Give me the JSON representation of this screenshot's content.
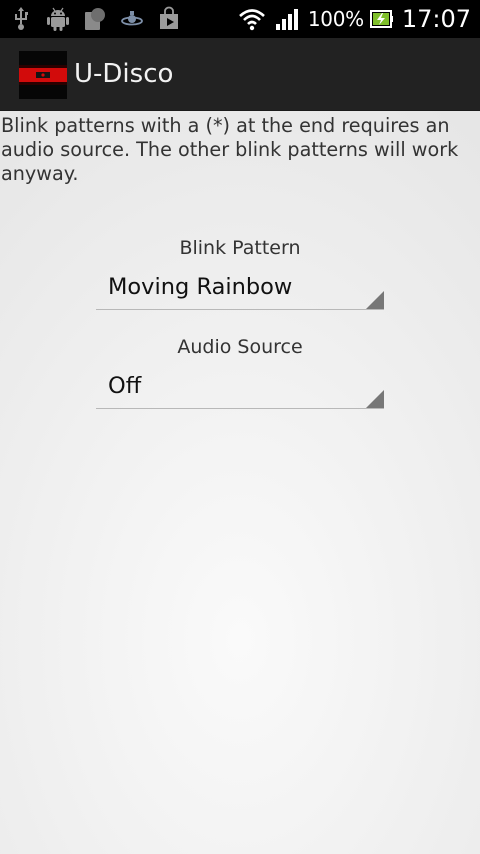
{
  "status_bar": {
    "left_icons": [
      "usb-icon",
      "android-debug-icon",
      "notification-icon",
      "sync-icon",
      "play-store-icon"
    ],
    "battery_percent": "100%",
    "time": "17:07"
  },
  "action_bar": {
    "title": "U-Disco"
  },
  "content": {
    "info_text": "Blink patterns with a (*) at the end requires an audio source. The other blink patterns will work anyway.",
    "blink_pattern": {
      "label": "Blink Pattern",
      "selected": "Moving Rainbow"
    },
    "audio_source": {
      "label": "Audio Source",
      "selected": "Off"
    }
  },
  "colors": {
    "status_bar_bg": "#000000",
    "action_bar_bg": "#222222",
    "text": "#333333",
    "spinner_line": "#b8b8b8"
  }
}
